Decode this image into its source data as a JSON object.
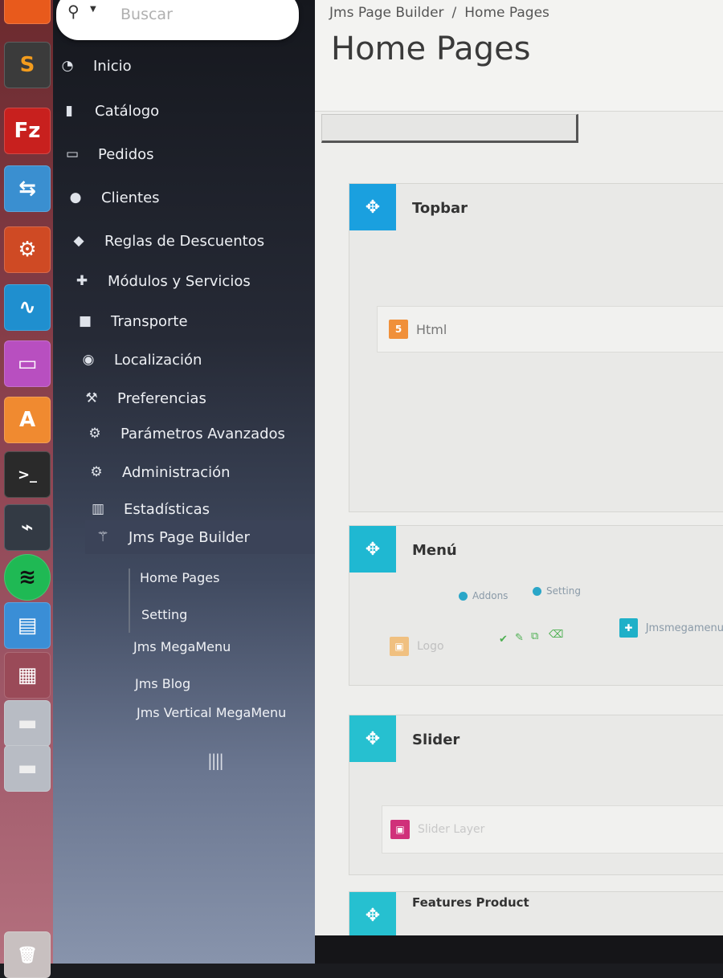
{
  "launcher": {
    "items": [
      {
        "name": "firefox-icon",
        "color": "#e85a1c",
        "glyph": ""
      },
      {
        "name": "sublime-icon",
        "color": "#3b3b3b",
        "glyph": "S"
      },
      {
        "name": "filezilla-icon",
        "color": "#c8201e",
        "glyph": "Fz"
      },
      {
        "name": "network-icon",
        "color": "#3a8fd0",
        "glyph": "⇆"
      },
      {
        "name": "settings-tool-icon",
        "color": "#cf4a24",
        "glyph": "⚙"
      },
      {
        "name": "system-monitor-icon",
        "color": "#1f8fcf",
        "glyph": "∿"
      },
      {
        "name": "window-app-icon",
        "color": "#b84fc0",
        "glyph": "▭"
      },
      {
        "name": "software-center-icon",
        "color": "#f08a30",
        "glyph": "A"
      },
      {
        "name": "terminal-icon",
        "color": "#2a2a2a",
        "glyph": ">_"
      },
      {
        "name": "activity-monitor-icon",
        "color": "#333a44",
        "glyph": "⌁"
      },
      {
        "name": "spotify-icon",
        "color": "#1fb954",
        "glyph": "≋"
      },
      {
        "name": "document-viewer-icon",
        "color": "#3a8ed6",
        "glyph": "▤"
      },
      {
        "name": "workspace-switcher-icon",
        "color": "#9a4a58",
        "glyph": "▦"
      },
      {
        "name": "drive-icon",
        "color": "#b8bcc4",
        "glyph": "▬"
      },
      {
        "name": "drive-icon-2",
        "color": "#b8bcc4",
        "glyph": "▬"
      },
      {
        "name": "trash-icon",
        "color": "#c8c0c0",
        "glyph": "🗑"
      }
    ]
  },
  "search": {
    "placeholder": "Buscar"
  },
  "sidebar": {
    "items": [
      {
        "label": "Inicio",
        "icon": "dashboard-icon",
        "glyph": "◔"
      },
      {
        "label": "Catálogo",
        "icon": "book-icon",
        "glyph": "▮"
      },
      {
        "label": "Pedidos",
        "icon": "credit-card-icon",
        "glyph": "▭"
      },
      {
        "label": "Clientes",
        "icon": "users-icon",
        "glyph": "●"
      },
      {
        "label": "Reglas de Descuentos",
        "icon": "tags-icon",
        "glyph": "◆"
      },
      {
        "label": "Módulos y Servicios",
        "icon": "puzzle-icon",
        "glyph": "✚"
      },
      {
        "label": "Transporte",
        "icon": "truck-icon",
        "glyph": "■"
      },
      {
        "label": "Localización",
        "icon": "globe-icon",
        "glyph": "◉"
      },
      {
        "label": "Preferencias",
        "icon": "wrench-icon",
        "glyph": "⚒"
      },
      {
        "label": "Parámetros Avanzados",
        "icon": "cogs-icon",
        "glyph": "⚙"
      },
      {
        "label": "Administración",
        "icon": "cog-icon",
        "glyph": "⚙"
      },
      {
        "label": "Estadísticas",
        "icon": "bar-chart-icon",
        "glyph": "▥"
      },
      {
        "label": "Jms Page Builder",
        "icon": "magic-wand-icon",
        "glyph": "⚚"
      }
    ],
    "subitems": [
      "Home Pages",
      "Setting"
    ],
    "extra_items": [
      "Jms MegaMenu",
      "Jms Blog",
      "Jms Vertical MegaMenu"
    ]
  },
  "breadcrumb": {
    "parent": "Jms Page Builder",
    "separator": "/",
    "current": "Home Pages"
  },
  "page": {
    "title": "Home Pages"
  },
  "sections": [
    {
      "title": "Topbar",
      "color": "#1aa0df",
      "blocks": [
        {
          "label": "Html",
          "badge": "5",
          "badge_color": "#f0903a"
        }
      ]
    },
    {
      "title": "Menú",
      "color": "#1fb8d2",
      "addons": "Addons",
      "setting": "Setting",
      "blocks": [
        {
          "label": "Logo",
          "badge": "▣",
          "badge_color": "#f0c080"
        },
        {
          "label": "Jmsmegamenu",
          "badge": "✚",
          "badge_color": "#1fb0c8"
        }
      ]
    },
    {
      "title": "Slider",
      "color": "#26c0d0",
      "blocks": [
        {
          "label": "Slider Layer",
          "badge": "▣",
          "badge_color": "#d0307a"
        }
      ]
    },
    {
      "title": "Features Product",
      "color": "#26c0d0",
      "blocks": []
    }
  ]
}
